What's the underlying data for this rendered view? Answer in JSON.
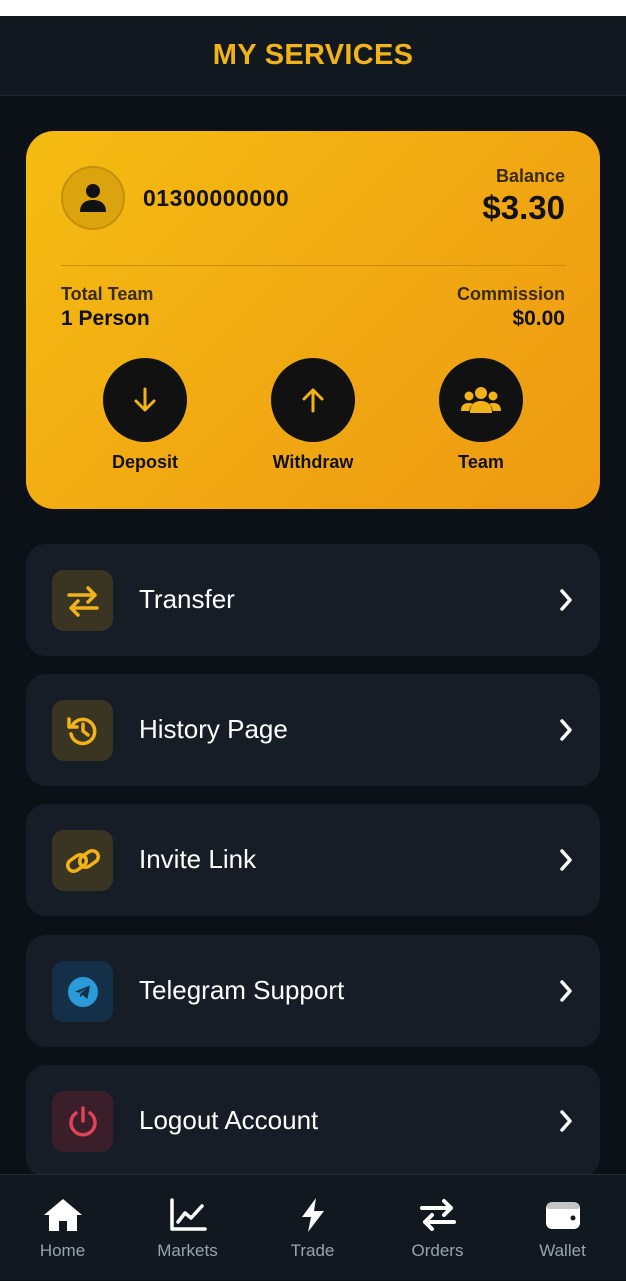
{
  "header": {
    "title": "MY SERVICES"
  },
  "card": {
    "phone": "01300000000",
    "balance_label": "Balance",
    "balance_value": "$3.30",
    "team_label": "Total Team",
    "team_value": "1 Person",
    "commission_label": "Commission",
    "commission_value": "$0.00",
    "actions": [
      {
        "label": "Deposit",
        "icon": "arrow-down-icon"
      },
      {
        "label": "Withdraw",
        "icon": "arrow-up-icon"
      },
      {
        "label": "Team",
        "icon": "users-icon"
      }
    ]
  },
  "menu": [
    {
      "label": "Transfer",
      "icon": "transfer-icon"
    },
    {
      "label": "History Page",
      "icon": "history-icon"
    },
    {
      "label": "Invite Link",
      "icon": "link-icon"
    },
    {
      "label": "Telegram Support",
      "icon": "telegram-icon"
    },
    {
      "label": "Logout Account",
      "icon": "power-icon"
    }
  ],
  "tabs": [
    {
      "label": "Home",
      "icon": "home-icon"
    },
    {
      "label": "Markets",
      "icon": "chart-line-icon"
    },
    {
      "label": "Trade",
      "icon": "bolt-icon"
    },
    {
      "label": "Orders",
      "icon": "exchange-icon"
    },
    {
      "label": "Wallet",
      "icon": "wallet-icon"
    }
  ],
  "colors": {
    "accent": "#f2b318",
    "background": "#0c1117",
    "card_item": "#161d26",
    "telegram": "#2a9ad8",
    "logout": "#e0425a"
  }
}
